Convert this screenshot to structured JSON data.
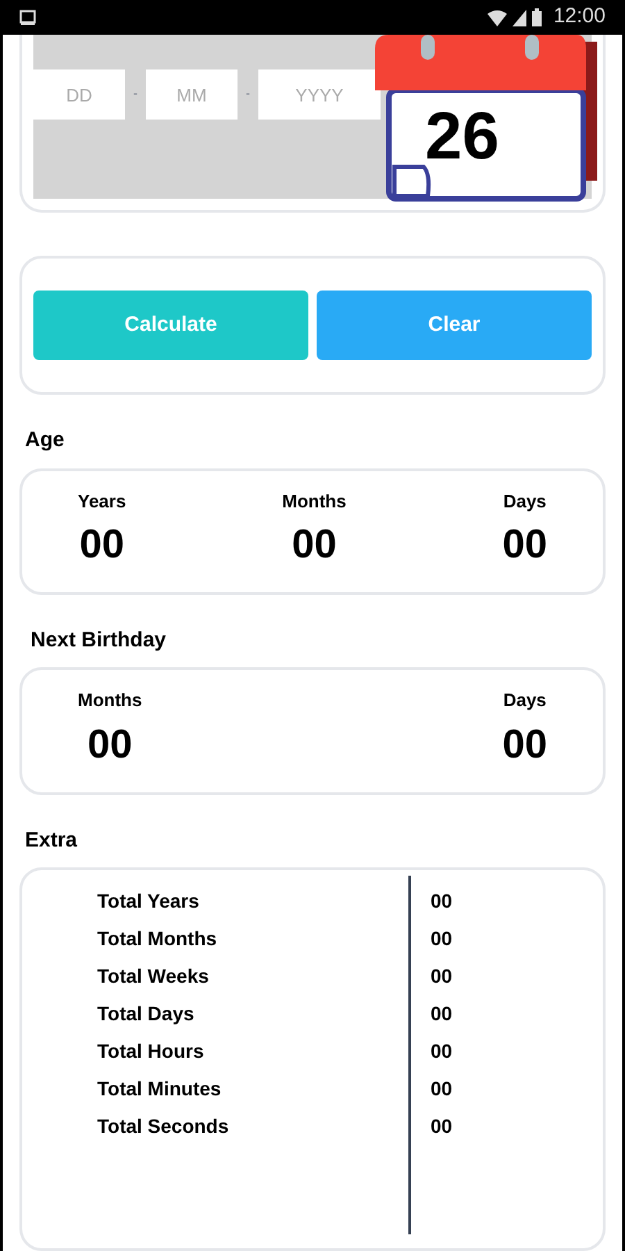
{
  "status_bar": {
    "time": "12:00"
  },
  "date_input": {
    "fields": [
      {
        "placeholder": "DD"
      },
      {
        "placeholder": "MM"
      },
      {
        "placeholder": "YYYY"
      }
    ],
    "separator": "-",
    "calendar_day": "26"
  },
  "buttons": [
    {
      "label": "Calculate",
      "color": "#1ec8c8"
    },
    {
      "label": "Clear",
      "color": "#29aaf5"
    }
  ],
  "age": {
    "title": "Age",
    "items": [
      {
        "label": "Years",
        "value": "00"
      },
      {
        "label": "Months",
        "value": "00"
      },
      {
        "label": "Days",
        "value": "00"
      }
    ]
  },
  "next_birthday": {
    "title": "Next Birthday",
    "items": [
      {
        "label": "Months",
        "value": "00"
      },
      {
        "label": "Days",
        "value": "00"
      }
    ]
  },
  "extra": {
    "title": "Extra",
    "rows": [
      {
        "label": "Total Years",
        "value": "00"
      },
      {
        "label": "Total Months",
        "value": "00"
      },
      {
        "label": "Total Weeks",
        "value": "00"
      },
      {
        "label": "Total Days",
        "value": "00"
      },
      {
        "label": "Total Hours",
        "value": "00"
      },
      {
        "label": "Total Minutes",
        "value": "00"
      },
      {
        "label": "Total Seconds",
        "value": "00"
      }
    ]
  }
}
